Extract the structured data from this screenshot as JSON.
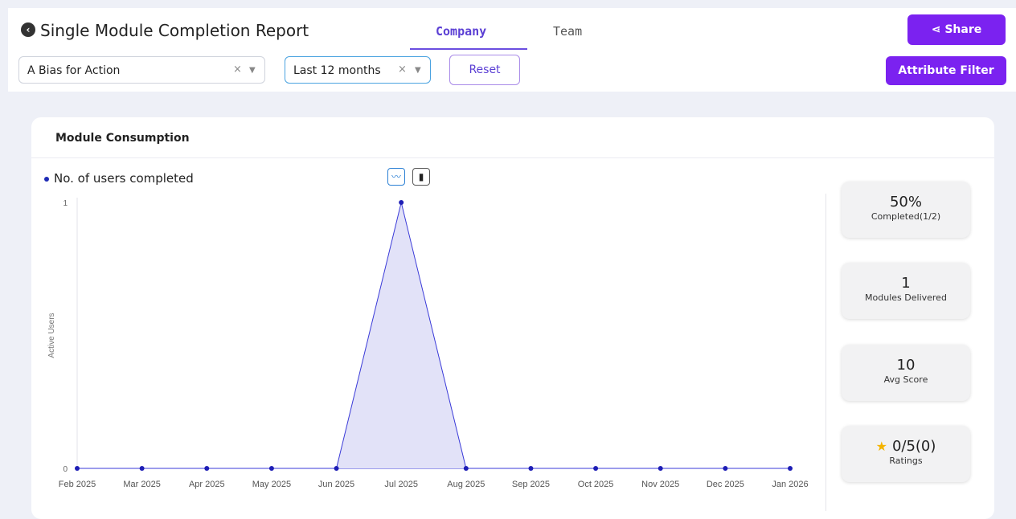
{
  "header": {
    "title": "Single Module Completion Report",
    "tabs": [
      "Company",
      "Team"
    ],
    "active_tab": "Company",
    "share_label": "Share",
    "accent": "#7b22f0"
  },
  "filters": {
    "module_value": "A Bias for Action",
    "period_value": "Last 12 months",
    "clear_glyph": "×",
    "reset_label": "Reset",
    "attribute_filter_label": "Attribute Filter"
  },
  "card": {
    "title": "Module Consumption",
    "legend_label": "No. of users completed"
  },
  "stats": [
    {
      "value": "50%",
      "label": "Completed(1/2)"
    },
    {
      "value": "1",
      "label": "Modules Delivered"
    },
    {
      "value": "10",
      "label": "Avg Score"
    },
    {
      "value": "0/5(0)",
      "label": "Ratings"
    }
  ],
  "chart_data": {
    "type": "area",
    "categories": [
      "Feb 2025",
      "Mar 2025",
      "Apr 2025",
      "May 2025",
      "Jun 2025",
      "Jul 2025",
      "Aug 2025",
      "Sep 2025",
      "Oct 2025",
      "Nov 2025",
      "Dec 2025",
      "Jan 2026"
    ],
    "series": [
      {
        "name": "No. of users completed",
        "values": [
          0,
          0,
          0,
          0,
          0,
          1,
          0,
          0,
          0,
          0,
          0,
          0
        ]
      }
    ],
    "ylabel": "Active Users",
    "yticks": [
      0,
      1
    ],
    "ylim": [
      0,
      1
    ],
    "line_color": "#3a3ad8",
    "fill_color": "#e2e2f8"
  }
}
